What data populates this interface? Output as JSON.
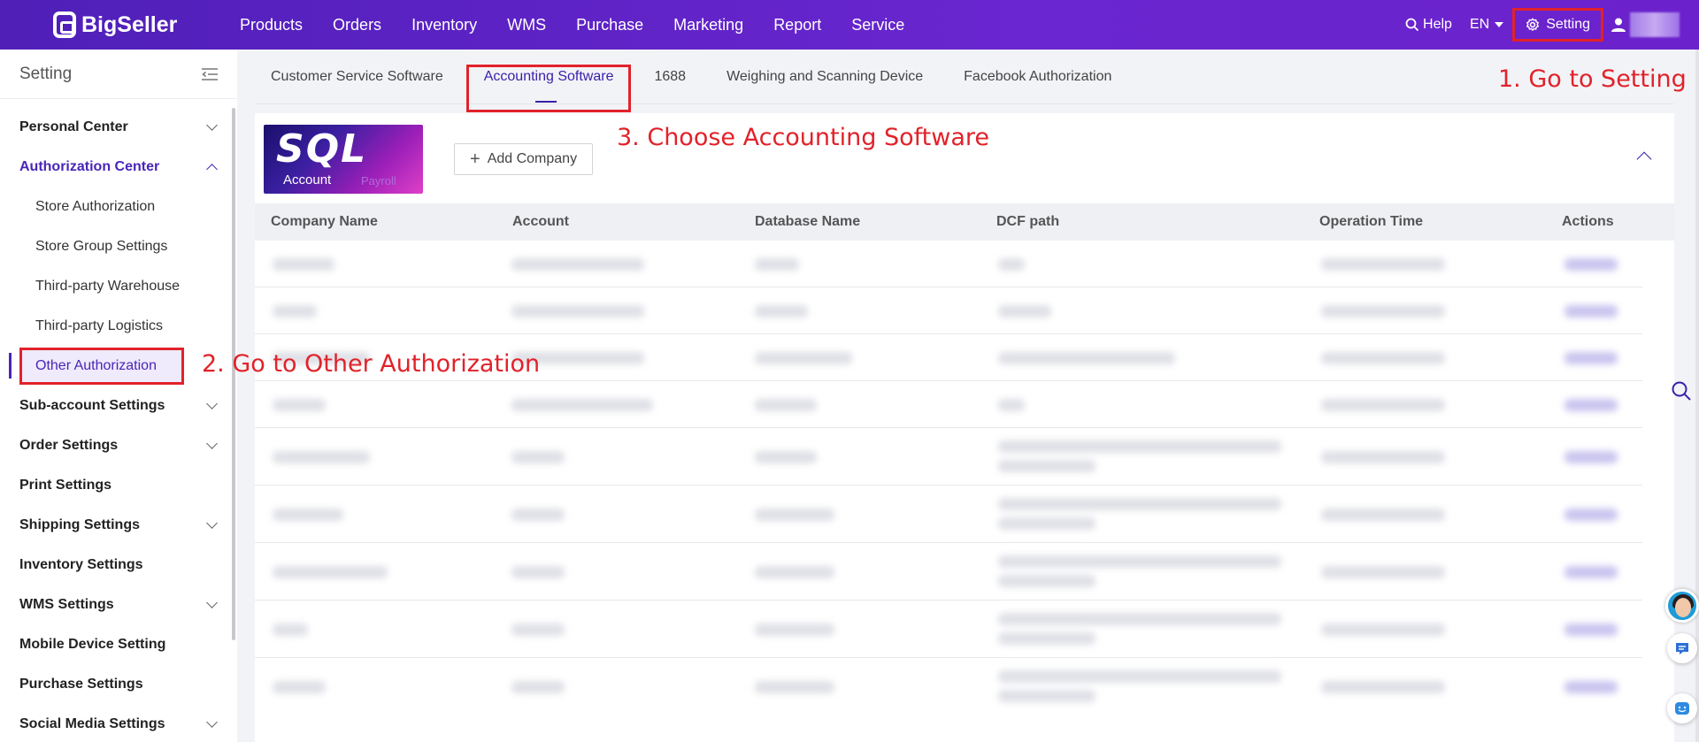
{
  "brand": {
    "name": "BigSeller"
  },
  "nav": [
    "Products",
    "Orders",
    "Inventory",
    "WMS",
    "Purchase",
    "Marketing",
    "Report",
    "Service"
  ],
  "topbar": {
    "help": "Help",
    "language": "EN",
    "setting": "Setting"
  },
  "sidebar": {
    "title": "Setting",
    "items": [
      {
        "label": "Personal Center",
        "expandable": true
      },
      {
        "label": "Authorization Center",
        "expandable": true,
        "expanded": true
      },
      {
        "label": "Store Authorization"
      },
      {
        "label": "Store Group Settings"
      },
      {
        "label": "Third-party Warehouse"
      },
      {
        "label": "Third-party Logistics"
      },
      {
        "label": "Other Authorization",
        "selected": true
      },
      {
        "label": "Sub-account Settings",
        "expandable": true
      },
      {
        "label": "Order Settings",
        "expandable": true
      },
      {
        "label": "Print Settings"
      },
      {
        "label": "Shipping Settings",
        "expandable": true
      },
      {
        "label": "Inventory Settings"
      },
      {
        "label": "WMS Settings",
        "expandable": true
      },
      {
        "label": "Mobile Device Setting"
      },
      {
        "label": "Purchase Settings"
      },
      {
        "label": "Social Media Settings",
        "expandable": true
      }
    ]
  },
  "tabs": [
    "Customer Service Software",
    "Accounting Software",
    "1688",
    "Weighing and Scanning Device",
    "Facebook Authorization"
  ],
  "active_tab": "Accounting Software",
  "card": {
    "logo_text": "SQL",
    "logo_sub": "Account",
    "logo_sub2": "Payroll",
    "add_button": "Add Company"
  },
  "table": {
    "columns": [
      "Company Name",
      "Account",
      "Database Name",
      "DCF path",
      "Operation Time",
      "Actions"
    ]
  },
  "annotations": {
    "step1": "1. Go to Setting",
    "step2": "2. Go to Other Authorization",
    "step3": "3. Choose Accounting Software"
  },
  "colors": {
    "brand": "#5b22c4",
    "accent": "#3b1fa8",
    "annotation": "#e1222a"
  }
}
